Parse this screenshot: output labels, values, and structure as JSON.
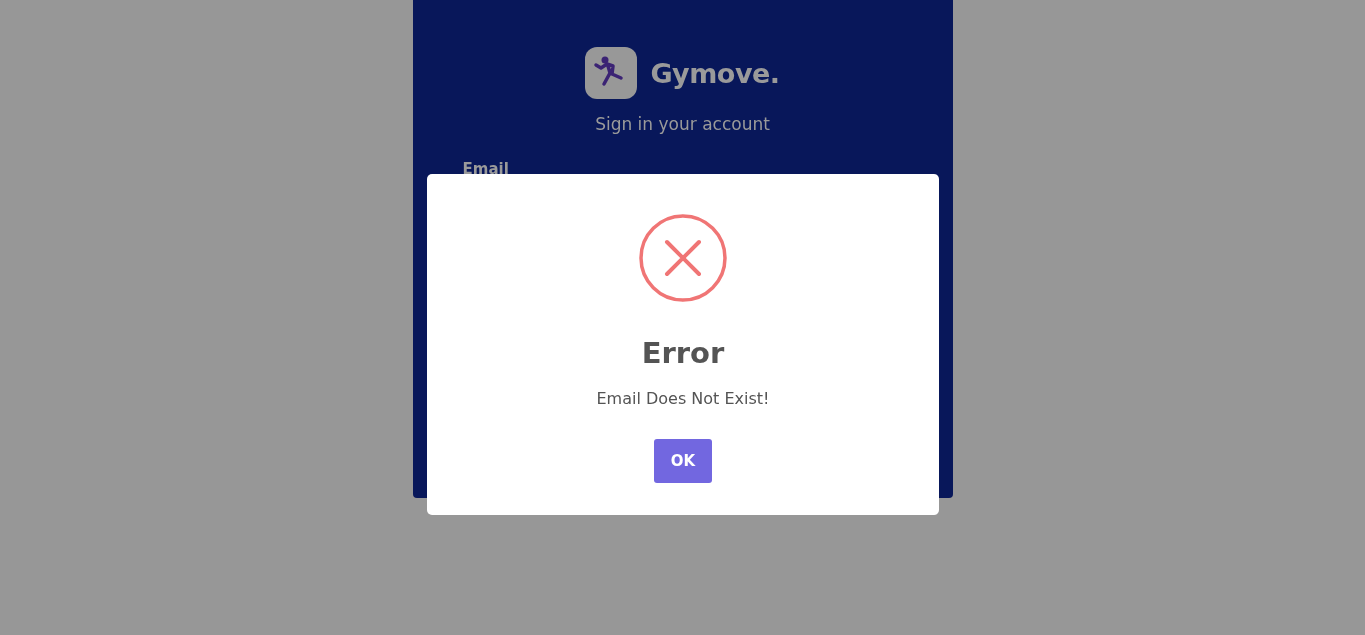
{
  "login": {
    "brand": "Gymove.",
    "subtitle": "Sign in your account",
    "email_label": "Email"
  },
  "dialog": {
    "title": "Error",
    "message": "Email Does Not Exist!",
    "button": "OK"
  }
}
